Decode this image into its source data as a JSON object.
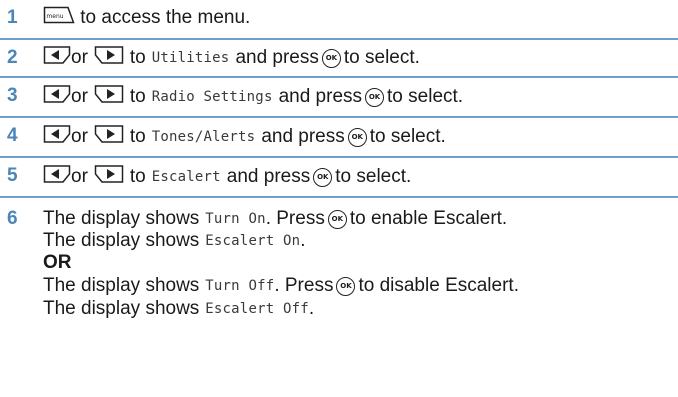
{
  "steps": [
    {
      "number": "1",
      "parts": {
        "icon": "menu-key-icon",
        "text_after": " to access the menu."
      },
      "menu_key_label": "menu"
    },
    {
      "number": "2",
      "parts": {
        "or": "or",
        "to": "to",
        "target": "Utilities",
        "press": "and press",
        "select": "to select."
      }
    },
    {
      "number": "3",
      "parts": {
        "or": "or",
        "to": "to",
        "target": "Radio Settings",
        "press": "and press",
        "select": "to select."
      }
    },
    {
      "number": "4",
      "parts": {
        "or": "or",
        "to": "to",
        "target": "Tones/Alerts",
        "press": "and press",
        "select": "to select."
      }
    },
    {
      "number": "5",
      "parts": {
        "or": "or",
        "to": "to",
        "target": "Escalert",
        "press": "and press",
        "select": "to select."
      }
    },
    {
      "number": "6",
      "lines": {
        "l1_a": "The display shows",
        "l1_code": "Turn On",
        "l1_b": ". Press",
        "l1_c": "to enable Escalert.",
        "l2_a": "The display shows",
        "l2_code": "Escalert On",
        "l2_b": ".",
        "or_label": "OR",
        "l4_a": "The display shows",
        "l4_code": "Turn Off",
        "l4_b": ". Press",
        "l4_c": "to disable Escalert.",
        "l5_a": "The display shows",
        "l5_code": "Escalert Off",
        "l5_b": "."
      }
    }
  ],
  "ok_key_label": "OK",
  "colors": {
    "step_number": "#4a86b8",
    "divider": "#6f9ec7",
    "text": "#1a1a1a"
  }
}
